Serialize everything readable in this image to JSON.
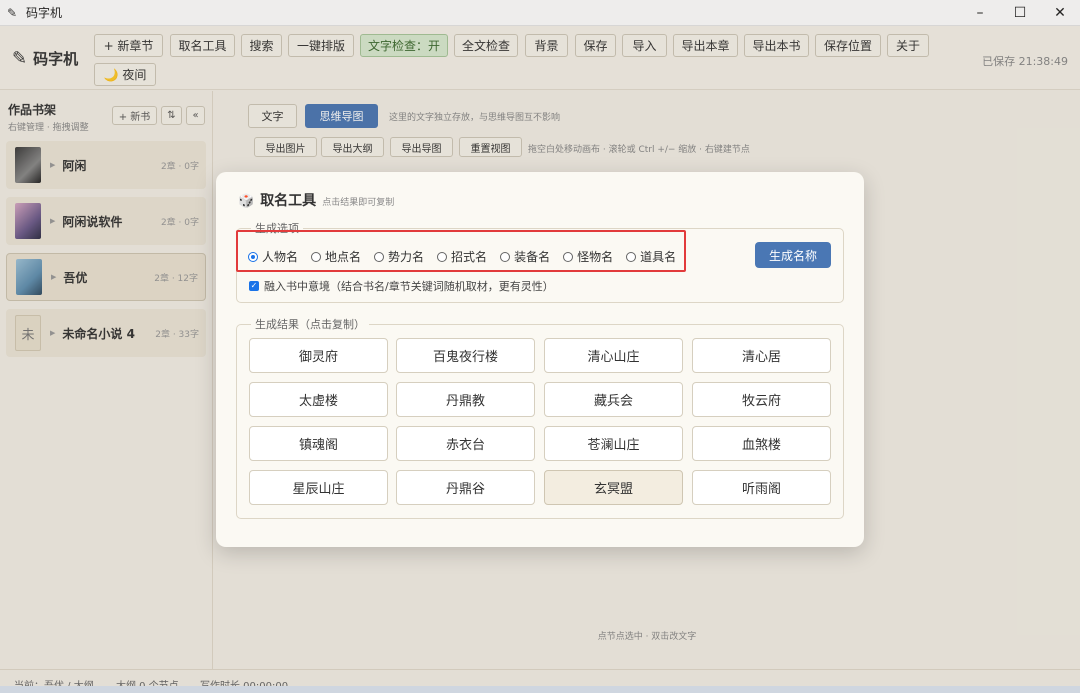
{
  "window": {
    "title": "码字机",
    "minimize": "–",
    "maximize": "☐",
    "close": "✕"
  },
  "toolbar": {
    "brand": "码字机",
    "buttons": [
      "+ 新章节",
      "取名工具",
      "搜索",
      "一键排版",
      "文字检查：开",
      "全文检查",
      "背景",
      "保存",
      "导入",
      "导出本章",
      "导出本书",
      "保存位置",
      "关于"
    ],
    "night": "🌙 夜间",
    "saved": "已保存 21:38:49"
  },
  "sidebar": {
    "title": "作品书架",
    "subtitle": "右键管理 · 拖拽调整",
    "new_book": "+ 新书",
    "sort": "⇅",
    "collapse": "«",
    "books": [
      {
        "name": "阿闲",
        "meta": "2章 · 0字"
      },
      {
        "name": "阿闲说软件",
        "meta": "2章 · 0字"
      },
      {
        "name": "吾优",
        "meta": "2章 · 12字"
      },
      {
        "name": "未命名小说 4",
        "meta": "2章 · 33字",
        "cover": "未"
      }
    ]
  },
  "main": {
    "tab_text": "文字",
    "tab_mindmap": "思维导图",
    "tab_hint": "这里的文字独立存放，与思维导图互不影响",
    "actions": [
      "导出图片",
      "导出大纲",
      "导出导图",
      "重置视图"
    ],
    "actions_hint": "拖空白处移动画布 · 滚轮或 Ctrl +/− 缩放 · 右键建节点",
    "canvas_hint": "点节点选中 · 双击改文字"
  },
  "status": {
    "current": "当前：吾优 / 大纲",
    "nodes": "大纲 0 个节点",
    "time": "写作时长 00:00:00"
  },
  "dialog": {
    "title": "取名工具",
    "subtitle": "点击结果即可复制",
    "options_legend": "生成选项",
    "types": [
      "人物名",
      "地点名",
      "势力名",
      "招式名",
      "装备名",
      "怪物名",
      "道具名"
    ],
    "selected_type": "人物名",
    "generate": "生成名称",
    "blend_label": "融入书中意境（结合书名/章节关键词随机取材，更有灵性）",
    "blend_checked": true,
    "results_legend": "生成结果（点击复制）",
    "results": [
      "御灵府",
      "百鬼夜行楼",
      "清心山庄",
      "清心居",
      "太虚楼",
      "丹鼎教",
      "藏兵会",
      "牧云府",
      "镇魂阁",
      "赤衣台",
      "苍澜山庄",
      "血煞楼",
      "星辰山庄",
      "丹鼎谷",
      "玄冥盟",
      "听雨阁"
    ]
  }
}
